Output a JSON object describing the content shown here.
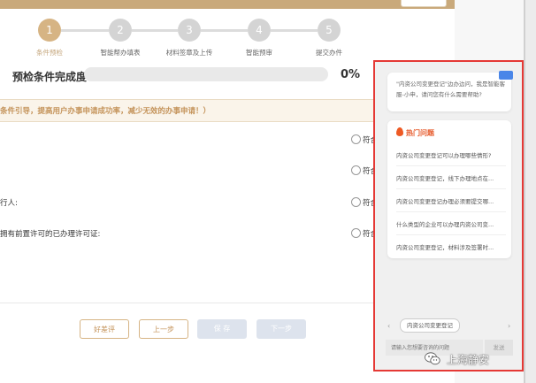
{
  "stepper": {
    "steps": [
      {
        "num": "1",
        "label": "条件预检"
      },
      {
        "num": "2",
        "label": "智能帮办填表"
      },
      {
        "num": "3",
        "label": "材料签章及上传"
      },
      {
        "num": "4",
        "label": "智能预审"
      },
      {
        "num": "5",
        "label": "提交办件"
      }
    ],
    "active": 1
  },
  "progress": {
    "title": "预检条件完成度",
    "percent_text": "0%",
    "value": 0
  },
  "notice": "条件引导，提高用户办事申请成功率，减少无效的办事申请！）",
  "questions": [
    {
      "label": "",
      "option": "符合"
    },
    {
      "label": "",
      "option": "符合"
    },
    {
      "label": "行人:",
      "option": "符合"
    },
    {
      "label": "拥有前置许可的已办理许可证:",
      "option": "符合"
    }
  ],
  "buttons": {
    "review": "好差评",
    "prev": "上一步",
    "save": "保 存",
    "next": "下一步"
  },
  "chat": {
    "greeting": "\"内资公司变更登记\"边办边问，我是智能客服-小申，请问您有什么需要帮助?",
    "hot_title": "热门问题",
    "hot_items": [
      "内资公司变更登记可以办理哪些情形?",
      "内资公司变更登记，线下办理地点在...",
      "内资公司变更登记办理必须要提交哪...",
      "什么类型的企业可以办理内资公司变...",
      "内资公司变更登记，材料涉及签署时..."
    ],
    "chip": "内资公司变更登记",
    "chip_prev": "‹",
    "chip_next": "›",
    "input_placeholder": "请输入您想要咨询的问题",
    "send": "发送"
  },
  "watermark": "上海静安",
  "colors": {
    "accent": "#d6b484",
    "highlight_border": "#e53935",
    "hot_title": "#e65a2b"
  }
}
